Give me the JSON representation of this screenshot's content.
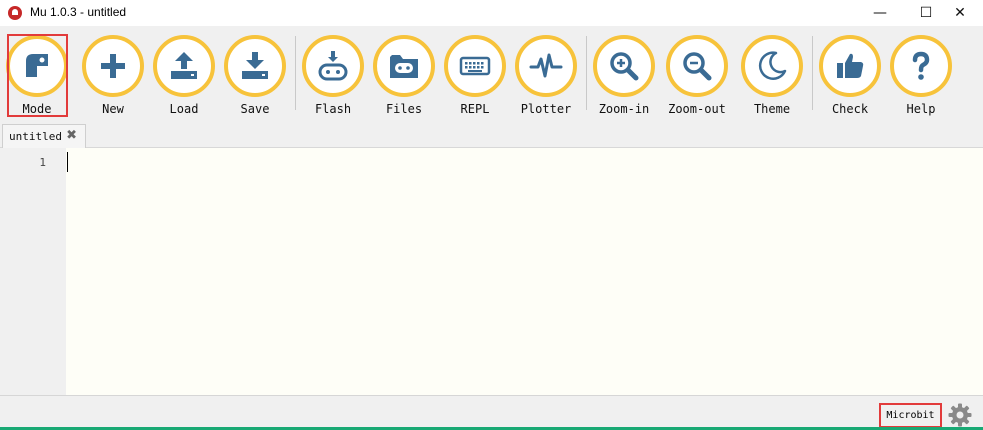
{
  "window": {
    "title": "Mu 1.0.3 - untitled",
    "minimize_glyph": "—",
    "maximize_glyph": "☐",
    "close_glyph": "✕"
  },
  "toolbar": {
    "buttons": [
      {
        "label": "Mode",
        "icon": "mode-icon"
      },
      {
        "label": "New",
        "icon": "plus-icon"
      },
      {
        "label": "Load",
        "icon": "upload-icon"
      },
      {
        "label": "Save",
        "icon": "download-icon"
      },
      {
        "label": "Flash",
        "icon": "flash-device-icon"
      },
      {
        "label": "Files",
        "icon": "folder-icon"
      },
      {
        "label": "REPL",
        "icon": "keyboard-icon"
      },
      {
        "label": "Plotter",
        "icon": "pulse-icon"
      },
      {
        "label": "Zoom-in",
        "icon": "zoom-in-icon"
      },
      {
        "label": "Zoom-out",
        "icon": "zoom-out-icon"
      },
      {
        "label": "Theme",
        "icon": "moon-icon"
      },
      {
        "label": "Check",
        "icon": "thumbs-up-icon"
      },
      {
        "label": "Help",
        "icon": "question-icon"
      }
    ]
  },
  "tabs": [
    {
      "label": "untitled",
      "close_glyph": "✖"
    }
  ],
  "editor": {
    "line_numbers": [
      "1"
    ]
  },
  "statusbar": {
    "mode": "Microbit",
    "settings_icon": "gear-icon"
  },
  "colors": {
    "icon_blue": "#3a6b94",
    "ring_yellow": "#f7c33b",
    "highlight_red": "#e23b3b",
    "editor_bg": "#fefef7"
  }
}
